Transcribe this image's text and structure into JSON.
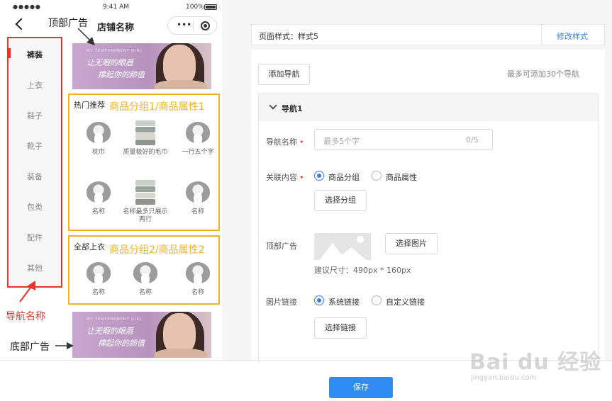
{
  "phone": {
    "status": {
      "signal": "●●●●● ",
      "time": "9:41 AM",
      "battery": "100%"
    },
    "shop_name": "店铺名称",
    "capsule_dots": "•••",
    "sidebar": [
      "裤装",
      "上衣",
      "鞋子",
      "靴子",
      "装备",
      "包类",
      "配件",
      "其他"
    ],
    "banner": {
      "small": "MY TEMPERAMENT GIRL",
      "line1": "让无暇的眼唇",
      "line2": "撑起你的颜值"
    },
    "group1": {
      "title": "热门推荐",
      "annotation": "商品分组1/商品属性1",
      "products": [
        {
          "name": "枕巾",
          "kind": "pillow"
        },
        {
          "name": "质量极好的毛巾",
          "kind": "towel"
        },
        {
          "name": "一行五个字",
          "kind": "pillow"
        },
        {
          "name": "名称",
          "kind": "pillow"
        },
        {
          "name": "名称最多只展示两行",
          "kind": "towel"
        },
        {
          "name": "名称",
          "kind": "pillow"
        }
      ]
    },
    "group2": {
      "title": "全部上衣",
      "annotation": "商品分组2/商品属性2",
      "products": [
        {
          "name": "名称",
          "kind": "pillow"
        },
        {
          "name": "名称",
          "kind": "pillow"
        },
        {
          "name": "名称",
          "kind": "pillow"
        }
      ]
    }
  },
  "annotations": {
    "top_ad": "顶部广告",
    "nav_name": "导航名称",
    "bottom_ad": "底部广告"
  },
  "settings": {
    "page_style_label": "页面样式：样式5",
    "edit_style_link": "修改样式",
    "add_nav_button": "添加导航",
    "max_nav_hint": "最多可添加30个导航",
    "section_title": "导航1",
    "nav_name_label": "导航名称",
    "nav_name_placeholder": "最多5个字",
    "nav_name_count": "0/5",
    "content_label": "关联内容",
    "content_options": [
      "商品分组",
      "商品属性"
    ],
    "select_group_button": "选择分组",
    "top_ad_label": "顶部广告",
    "select_image_button": "选择图片",
    "size_hint": "建议尺寸：490px * 160px",
    "link_label": "图片链接",
    "link_options": [
      "系统链接",
      "自定义链接"
    ],
    "select_link_button": "选择链接"
  },
  "footer": {
    "save_button": "保存"
  },
  "watermark": {
    "line1": "Bai du 经验",
    "line2": "jingyan.baidu.com"
  },
  "colors": {
    "accent": "#2f8cf0",
    "annotation_red": "#e8352b",
    "annotation_yellow": "#f2b423",
    "link": "#3a7de8"
  }
}
